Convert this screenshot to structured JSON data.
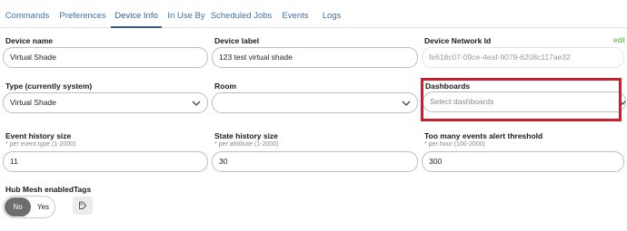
{
  "tabs": [
    {
      "label": "Commands",
      "active": false
    },
    {
      "label": "Preferences",
      "active": false
    },
    {
      "label": "Device Info",
      "active": true
    },
    {
      "label": "In Use By",
      "active": false
    },
    {
      "label": "Scheduled Jobs",
      "active": false
    },
    {
      "label": "Events",
      "active": false
    },
    {
      "label": "Logs",
      "active": false
    }
  ],
  "device_name": {
    "label": "Device name",
    "value": "Virtual Shade"
  },
  "device_label": {
    "label": "Device label",
    "value": "123 test virtual shade"
  },
  "network_id": {
    "label": "Device Network Id",
    "value": "fe618c07-09ce-4eaf-9079-6208c117ae32",
    "edit_label": "edit"
  },
  "type": {
    "label": "Type (currently system)",
    "value": "Virtual Shade"
  },
  "room": {
    "label": "Room",
    "value": ""
  },
  "dashboards": {
    "label": "Dashboards",
    "placeholder": "Select dashboards"
  },
  "event_history": {
    "label": "Event history size",
    "hint": "* per event type (1-2000)",
    "value": "11"
  },
  "state_history": {
    "label": "State history size",
    "hint": "* per attribute (1-2000)",
    "value": "30"
  },
  "events_threshold": {
    "label": "Too many events alert threshold",
    "hint": "* per hour (100-2000)",
    "value": "300"
  },
  "hub_mesh": {
    "label": "Hub Mesh enabled",
    "no_label": "No",
    "yes_label": "Yes",
    "selected": "No"
  },
  "tags": {
    "label": "Tags"
  },
  "colors": {
    "tab_text": "#3e6fa8",
    "highlight_border": "#c8202a",
    "edit_link": "#54a832",
    "toggle_selected": "#6e6e6e"
  },
  "icons": {
    "select_chevron": "chevron-down-icon",
    "tag_button": "tag-icon"
  }
}
